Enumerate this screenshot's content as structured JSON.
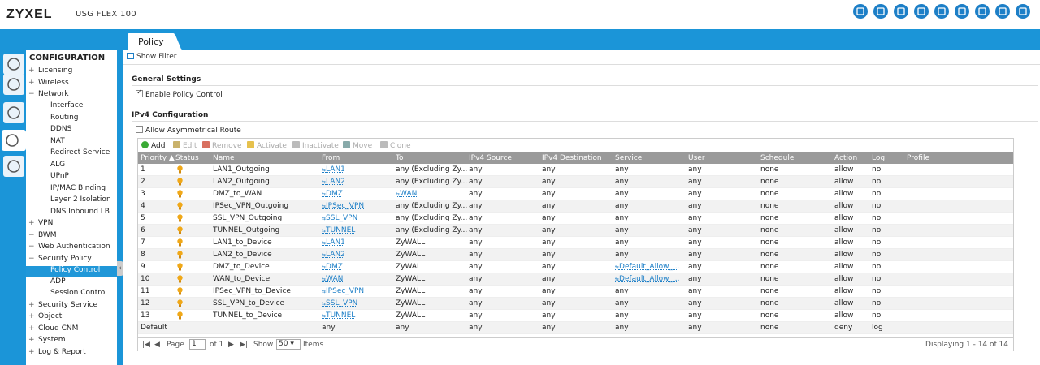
{
  "header": {
    "brand": "ZYXEL",
    "model": "USG FLEX 100",
    "icons": [
      "shield-icon",
      "console-icon",
      "cli-icon",
      "wizard-icon",
      "network-icon",
      "chat-icon",
      "help-book-icon",
      "info-icon",
      "logout-icon"
    ]
  },
  "tabs": [
    {
      "label": "Policy"
    }
  ],
  "left_icons": [
    "dashboard-icon",
    "wand-icon",
    "monitor-icon",
    "gear-icon",
    "tools-icon"
  ],
  "sidebar": {
    "title": "CONFIGURATION",
    "items": [
      {
        "label": "Licensing",
        "pm": "+",
        "level": "top"
      },
      {
        "label": "Wireless",
        "pm": "+",
        "level": "top"
      },
      {
        "label": "Network",
        "pm": "−",
        "level": "top"
      },
      {
        "label": "Interface",
        "pm": "",
        "level": "sub"
      },
      {
        "label": "Routing",
        "pm": "",
        "level": "sub"
      },
      {
        "label": "DDNS",
        "pm": "",
        "level": "sub"
      },
      {
        "label": "NAT",
        "pm": "",
        "level": "sub"
      },
      {
        "label": "Redirect Service",
        "pm": "",
        "level": "sub"
      },
      {
        "label": "ALG",
        "pm": "",
        "level": "sub"
      },
      {
        "label": "UPnP",
        "pm": "",
        "level": "sub"
      },
      {
        "label": "IP/MAC Binding",
        "pm": "",
        "level": "sub"
      },
      {
        "label": "Layer 2 Isolation",
        "pm": "",
        "level": "sub"
      },
      {
        "label": "DNS Inbound LB",
        "pm": "",
        "level": "sub"
      },
      {
        "label": "VPN",
        "pm": "+",
        "level": "top"
      },
      {
        "label": "BWM",
        "pm": "−",
        "level": "top"
      },
      {
        "label": "Web Authentication",
        "pm": "−",
        "level": "top"
      },
      {
        "label": "Security Policy",
        "pm": "−",
        "level": "top"
      },
      {
        "label": "Policy Control",
        "pm": "",
        "level": "sub",
        "active": true
      },
      {
        "label": "ADP",
        "pm": "",
        "level": "sub"
      },
      {
        "label": "Session Control",
        "pm": "",
        "level": "sub"
      },
      {
        "label": "Security Service",
        "pm": "+",
        "level": "top"
      },
      {
        "label": "Object",
        "pm": "+",
        "level": "top"
      },
      {
        "label": "Cloud CNM",
        "pm": "+",
        "level": "top"
      },
      {
        "label": "System",
        "pm": "+",
        "level": "top"
      },
      {
        "label": "Log & Report",
        "pm": "+",
        "level": "top"
      }
    ]
  },
  "main": {
    "show_filter": "Show Filter",
    "general_settings": "General Settings",
    "enable_policy_control": "Enable Policy Control",
    "enable_policy_control_checked": true,
    "ipv4_config": "IPv4 Configuration",
    "allow_asym": "Allow Asymmetrical Route",
    "allow_asym_checked": false
  },
  "toolbar": [
    {
      "label": "Add",
      "enabled": true,
      "icon": "add-icon"
    },
    {
      "label": "Edit",
      "enabled": false,
      "icon": "edit-icon"
    },
    {
      "label": "Remove",
      "enabled": false,
      "icon": "trash-icon"
    },
    {
      "label": "Activate",
      "enabled": false,
      "icon": "bulb-on-icon"
    },
    {
      "label": "Inactivate",
      "enabled": false,
      "icon": "bulb-off-icon"
    },
    {
      "label": "Move",
      "enabled": false,
      "icon": "move-icon"
    },
    {
      "label": "Clone",
      "enabled": false,
      "icon": "clone-icon"
    }
  ],
  "table": {
    "columns": [
      "Priority ▲",
      "Status",
      "Name",
      "From",
      "To",
      "IPv4 Source",
      "IPv4 Destination",
      "Service",
      "User",
      "Schedule",
      "Action",
      "Log",
      "Profile"
    ],
    "rows": [
      {
        "priority": "1",
        "name": "LAN1_Outgoing",
        "from": "LAN1",
        "to": "any (Excluding Zy...",
        "src": "any",
        "dst": "any",
        "service": "any",
        "user": "any",
        "schedule": "none",
        "action": "allow",
        "log": "no"
      },
      {
        "priority": "2",
        "name": "LAN2_Outgoing",
        "from": "LAN2",
        "to": "any (Excluding Zy...",
        "src": "any",
        "dst": "any",
        "service": "any",
        "user": "any",
        "schedule": "none",
        "action": "allow",
        "log": "no"
      },
      {
        "priority": "3",
        "name": "DMZ_to_WAN",
        "from": "DMZ",
        "to": "WAN",
        "to_link": true,
        "src": "any",
        "dst": "any",
        "service": "any",
        "user": "any",
        "schedule": "none",
        "action": "allow",
        "log": "no"
      },
      {
        "priority": "4",
        "name": "IPSec_VPN_Outgoing",
        "from": "IPSec_VPN",
        "to": "any (Excluding Zy...",
        "src": "any",
        "dst": "any",
        "service": "any",
        "user": "any",
        "schedule": "none",
        "action": "allow",
        "log": "no"
      },
      {
        "priority": "5",
        "name": "SSL_VPN_Outgoing",
        "from": "SSL_VPN",
        "to": "any (Excluding Zy...",
        "src": "any",
        "dst": "any",
        "service": "any",
        "user": "any",
        "schedule": "none",
        "action": "allow",
        "log": "no"
      },
      {
        "priority": "6",
        "name": "TUNNEL_Outgoing",
        "from": "TUNNEL",
        "to": "any (Excluding Zy...",
        "src": "any",
        "dst": "any",
        "service": "any",
        "user": "any",
        "schedule": "none",
        "action": "allow",
        "log": "no"
      },
      {
        "priority": "7",
        "name": "LAN1_to_Device",
        "from": "LAN1",
        "to": "ZyWALL",
        "src": "any",
        "dst": "any",
        "service": "any",
        "user": "any",
        "schedule": "none",
        "action": "allow",
        "log": "no"
      },
      {
        "priority": "8",
        "name": "LAN2_to_Device",
        "from": "LAN2",
        "to": "ZyWALL",
        "src": "any",
        "dst": "any",
        "service": "any",
        "user": "any",
        "schedule": "none",
        "action": "allow",
        "log": "no"
      },
      {
        "priority": "9",
        "name": "DMZ_to_Device",
        "from": "DMZ",
        "to": "ZyWALL",
        "src": "any",
        "dst": "any",
        "service": "Default_Allow_...",
        "service_link": true,
        "user": "any",
        "schedule": "none",
        "action": "allow",
        "log": "no"
      },
      {
        "priority": "10",
        "name": "WAN_to_Device",
        "from": "WAN",
        "to": "ZyWALL",
        "src": "any",
        "dst": "any",
        "service": "Default_Allow_...",
        "service_link": true,
        "user": "any",
        "schedule": "none",
        "action": "allow",
        "log": "no"
      },
      {
        "priority": "11",
        "name": "IPSec_VPN_to_Device",
        "from": "IPSec_VPN",
        "to": "ZyWALL",
        "src": "any",
        "dst": "any",
        "service": "any",
        "user": "any",
        "schedule": "none",
        "action": "allow",
        "log": "no"
      },
      {
        "priority": "12",
        "name": "SSL_VPN_to_Device",
        "from": "SSL_VPN",
        "to": "ZyWALL",
        "src": "any",
        "dst": "any",
        "service": "any",
        "user": "any",
        "schedule": "none",
        "action": "allow",
        "log": "no"
      },
      {
        "priority": "13",
        "name": "TUNNEL_to_Device",
        "from": "TUNNEL",
        "to": "ZyWALL",
        "src": "any",
        "dst": "any",
        "service": "any",
        "user": "any",
        "schedule": "none",
        "action": "allow",
        "log": "no"
      }
    ],
    "default_row": {
      "priority": "Default",
      "from": "any",
      "to": "any",
      "src": "any",
      "dst": "any",
      "service": "any",
      "user": "any",
      "schedule": "none",
      "action": "deny",
      "log": "log"
    }
  },
  "pager": {
    "page_label": "Page",
    "page_value": "1",
    "of_label": "of 1",
    "show_label": "Show",
    "show_value": "50",
    "items_label": "Items",
    "displaying": "Displaying 1 - 14 of 14"
  },
  "colors": {
    "accent": "#1b95d8",
    "link": "#1d7fc7",
    "bulb": "#f0a818",
    "header_gray": "#9a9a9a"
  }
}
